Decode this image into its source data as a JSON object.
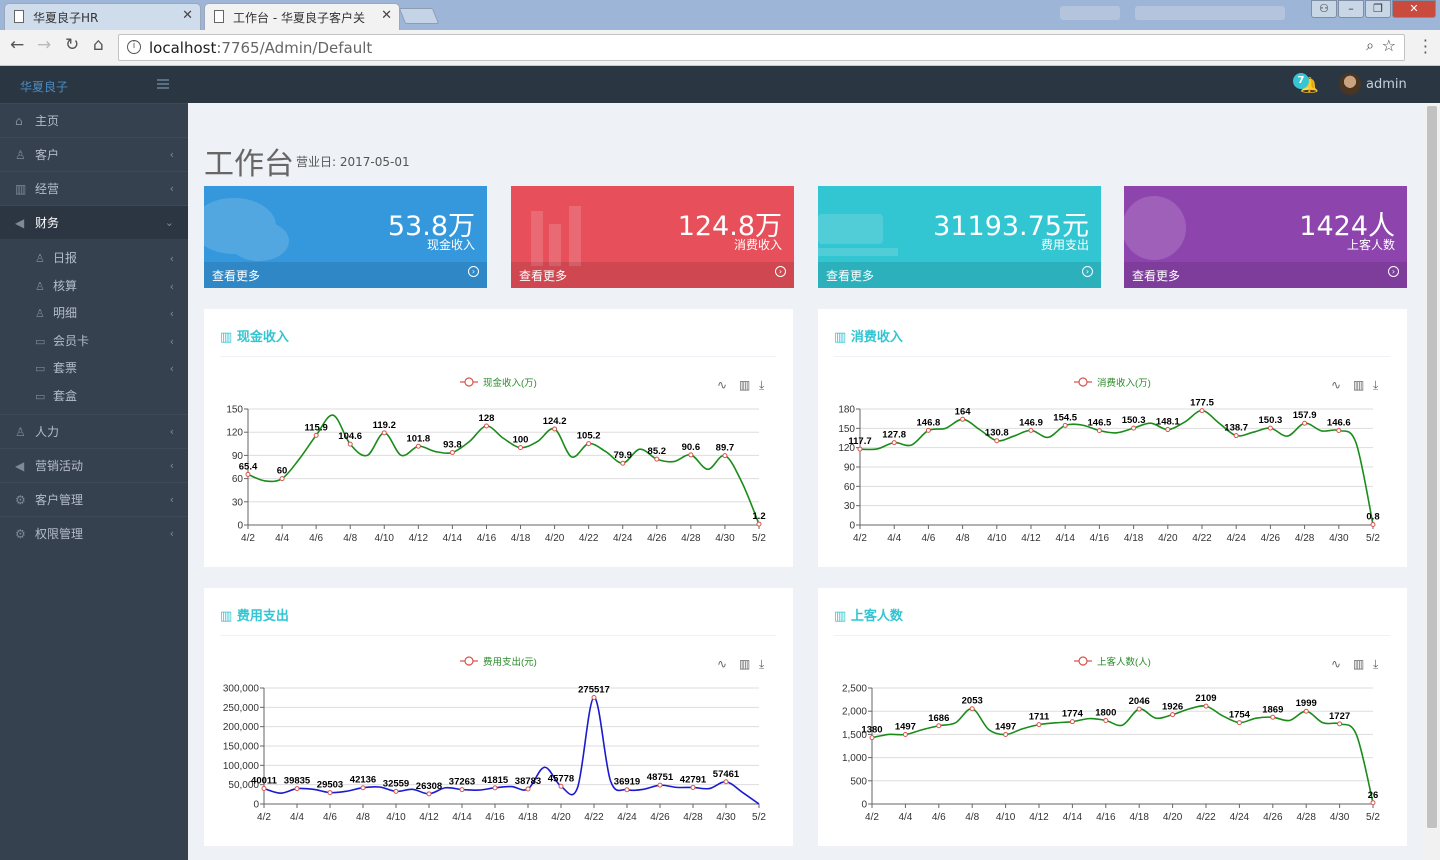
{
  "browser": {
    "tabs": [
      {
        "title": "华夏良子HR"
      },
      {
        "title": "工作台 - 华夏良子客户关"
      }
    ],
    "url_host": "localhost",
    "url_path": ":7765/Admin/Default"
  },
  "header": {
    "logo": "华夏良子",
    "badge": "7",
    "username": "admin"
  },
  "sidebar": {
    "items": [
      {
        "label": "主页",
        "icon": "home-icon"
      },
      {
        "label": "客户",
        "icon": "user-icon"
      },
      {
        "label": "经营",
        "icon": "bar-chart-icon"
      },
      {
        "label": "财务",
        "icon": "bullhorn-icon"
      },
      {
        "label": "人力",
        "icon": "users-icon"
      },
      {
        "label": "营销活动",
        "icon": "bullhorn-icon"
      },
      {
        "label": "客户管理",
        "icon": "gear-icon"
      },
      {
        "label": "权限管理",
        "icon": "gear-icon"
      }
    ],
    "finance_sub": [
      {
        "label": "日报",
        "icon": "user-icon"
      },
      {
        "label": "核算",
        "icon": "user-icon"
      },
      {
        "label": "明细",
        "icon": "user-icon"
      },
      {
        "label": "会员卡",
        "icon": "card-icon"
      },
      {
        "label": "套票",
        "icon": "card-icon"
      },
      {
        "label": "套盒",
        "icon": "card-icon"
      }
    ]
  },
  "page": {
    "title": "工作台",
    "subtitle": "营业日: 2017-05-01"
  },
  "stats": [
    {
      "value": "53.8万",
      "label": "现金收入",
      "more": "查看更多",
      "color": "#3598dc"
    },
    {
      "value": "124.8万",
      "label": "消费收入",
      "more": "查看更多",
      "color": "#e7505a"
    },
    {
      "value": "31193.75元",
      "label": "费用支出",
      "more": "查看更多",
      "color": "#32c5d2"
    },
    {
      "value": "1424人",
      "label": "上客人数",
      "more": "查看更多",
      "color": "#8e44ad"
    }
  ],
  "chart_data": [
    {
      "type": "line",
      "title": "现金收入",
      "legend": "现金收入(万)",
      "x": [
        "4/2",
        "4/3",
        "4/4",
        "4/5",
        "4/6",
        "4/7",
        "4/8",
        "4/9",
        "4/10",
        "4/11",
        "4/12",
        "4/13",
        "4/14",
        "4/15",
        "4/16",
        "4/17",
        "4/18",
        "4/19",
        "4/20",
        "4/21",
        "4/22",
        "4/23",
        "4/24",
        "4/25",
        "4/26",
        "4/27",
        "4/28",
        "4/29",
        "4/30",
        "5/1",
        "5/2"
      ],
      "x_ticks": [
        "4/2",
        "4/4",
        "4/6",
        "4/8",
        "4/10",
        "4/12",
        "4/14",
        "4/16",
        "4/18",
        "4/20",
        "4/22",
        "4/24",
        "4/26",
        "4/28",
        "4/30",
        "5/2"
      ],
      "values": [
        65.4,
        57,
        60,
        85,
        115.9,
        142,
        104.6,
        90,
        119.2,
        90,
        101.8,
        95,
        93.8,
        108,
        128,
        112,
        100,
        108,
        124.2,
        88,
        105.2,
        95,
        79.9,
        98,
        85.2,
        82,
        90.6,
        72,
        89.7,
        55,
        1.2
      ],
      "labels": {
        "0": "65.4",
        "2": "60",
        "4": "115.9",
        "6": "104.6",
        "8": "119.2",
        "10": "101.8",
        "12": "93.8",
        "14": "128",
        "16": "100",
        "18": "124.2",
        "20": "105.2",
        "22": "79.9",
        "24": "85.2",
        "26": "90.6",
        "28": "89.7",
        "30": "1.2"
      },
      "ylim": [
        0,
        150
      ],
      "yticks": [
        "0",
        "30",
        "60",
        "90",
        "120",
        "150"
      ],
      "line_color": "#1a8c1a",
      "grid": true
    },
    {
      "type": "line",
      "title": "消费收入",
      "legend": "消费收入(万)",
      "x": [
        "4/2",
        "4/3",
        "4/4",
        "4/5",
        "4/6",
        "4/7",
        "4/8",
        "4/9",
        "4/10",
        "4/11",
        "4/12",
        "4/13",
        "4/14",
        "4/15",
        "4/16",
        "4/17",
        "4/18",
        "4/19",
        "4/20",
        "4/21",
        "4/22",
        "4/23",
        "4/24",
        "4/25",
        "4/26",
        "4/27",
        "4/28",
        "4/29",
        "4/30",
        "5/1",
        "5/2"
      ],
      "x_ticks": [
        "4/2",
        "4/4",
        "4/6",
        "4/8",
        "4/10",
        "4/12",
        "4/14",
        "4/16",
        "4/18",
        "4/20",
        "4/22",
        "4/24",
        "4/26",
        "4/28",
        "4/30",
        "5/2"
      ],
      "values": [
        117.7,
        118,
        127.8,
        124,
        146.8,
        150,
        164,
        148,
        130.8,
        138,
        146.9,
        136,
        154.5,
        155,
        146.5,
        143,
        150.3,
        158,
        148.1,
        160,
        177.5,
        158,
        138.7,
        144,
        150.3,
        138,
        157.9,
        146,
        146.6,
        128,
        0.8
      ],
      "labels": {
        "0": "117.7",
        "2": "127.8",
        "4": "146.8",
        "6": "164",
        "8": "130.8",
        "10": "146.9",
        "12": "154.5",
        "14": "146.5",
        "16": "150.3",
        "18": "148.1",
        "20": "177.5",
        "22": "138.7",
        "24": "150.3",
        "26": "157.9",
        "28": "146.6",
        "30": "0.8"
      },
      "ylim": [
        0,
        180
      ],
      "yticks": [
        "0",
        "30",
        "60",
        "90",
        "120",
        "150",
        "180"
      ],
      "line_color": "#1a8c1a",
      "grid": true
    },
    {
      "type": "line",
      "title": "费用支出",
      "legend": "费用支出(元)",
      "x": [
        "4/2",
        "4/3",
        "4/4",
        "4/5",
        "4/6",
        "4/7",
        "4/8",
        "4/9",
        "4/10",
        "4/11",
        "4/12",
        "4/13",
        "4/14",
        "4/15",
        "4/16",
        "4/17",
        "4/18",
        "4/19",
        "4/20",
        "4/21",
        "4/22",
        "4/23",
        "4/24",
        "4/25",
        "4/26",
        "4/27",
        "4/28",
        "4/29",
        "4/30",
        "5/1",
        "5/2"
      ],
      "x_ticks": [
        "4/2",
        "4/4",
        "4/6",
        "4/8",
        "4/10",
        "4/12",
        "4/14",
        "4/16",
        "4/18",
        "4/20",
        "4/22",
        "4/24",
        "4/26",
        "4/28",
        "4/30",
        "5/2"
      ],
      "values": [
        40011,
        28000,
        39835,
        38000,
        29503,
        33000,
        42136,
        44000,
        32559,
        38000,
        26308,
        42000,
        37263,
        36000,
        41815,
        45000,
        38783,
        95000,
        45778,
        42000,
        275517,
        60000,
        36919,
        38000,
        48751,
        43000,
        42791,
        40000,
        57461,
        30000,
        0
      ],
      "labels": {
        "0": "40011",
        "2": "39835",
        "4": "29503",
        "6": "42136",
        "8": "32559",
        "10": "26308",
        "12": "37263",
        "14": "41815",
        "16": "38783",
        "18": "45778",
        "20": "275517",
        "22": "36919",
        "24": "48751",
        "26": "42791",
        "28": "57461"
      },
      "ylim": [
        0,
        300000
      ],
      "yticks": [
        "0",
        "50,000",
        "100,000",
        "150,000",
        "200,000",
        "250,000",
        "300,000"
      ],
      "line_color": "#1a1ad1",
      "grid": true
    },
    {
      "type": "line",
      "title": "上客人数",
      "legend": "上客人数(人)",
      "x": [
        "4/2",
        "4/3",
        "4/4",
        "4/5",
        "4/6",
        "4/7",
        "4/8",
        "4/9",
        "4/10",
        "4/11",
        "4/12",
        "4/13",
        "4/14",
        "4/15",
        "4/16",
        "4/17",
        "4/18",
        "4/19",
        "4/20",
        "4/21",
        "4/22",
        "4/23",
        "4/24",
        "4/25",
        "4/26",
        "4/27",
        "4/28",
        "4/29",
        "4/30",
        "5/1",
        "5/2"
      ],
      "x_ticks": [
        "4/2",
        "4/4",
        "4/6",
        "4/8",
        "4/10",
        "4/12",
        "4/14",
        "4/16",
        "4/18",
        "4/20",
        "4/22",
        "4/24",
        "4/26",
        "4/28",
        "4/30",
        "5/2"
      ],
      "values": [
        1430,
        1500,
        1497,
        1600,
        1686,
        1750,
        2053,
        1600,
        1497,
        1620,
        1711,
        1750,
        1774,
        1840,
        1800,
        1700,
        2046,
        1850,
        1926,
        2050,
        2109,
        1900,
        1754,
        1850,
        1869,
        1800,
        1999,
        1750,
        1727,
        1500,
        26
      ],
      "labels": {
        "0": "1380",
        "2": "1497",
        "4": "1686",
        "6": "2053",
        "8": "1497",
        "10": "1711",
        "12": "1774",
        "14": "1800",
        "16": "2046",
        "18": "1926",
        "20": "2109",
        "22": "1754",
        "24": "1869",
        "26": "1999",
        "28": "1727",
        "30": "26"
      },
      "ylim": [
        0,
        2500
      ],
      "yticks": [
        "0",
        "500",
        "1,000",
        "1,500",
        "2,000",
        "2,500"
      ],
      "line_color": "#1a8c1a",
      "grid": true
    }
  ]
}
